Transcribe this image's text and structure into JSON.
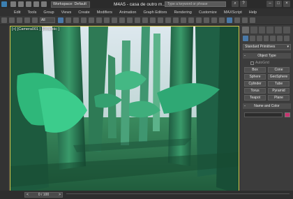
{
  "titlebar": {
    "workspace": "Workspace: Default",
    "doc_title": "M4A5 - casa de outro m...",
    "search_placeholder": "Type a keyword or phrase"
  },
  "menu": [
    "Edit",
    "Tools",
    "Group",
    "Views",
    "Create",
    "Modifiers",
    "Animation",
    "Graph Editors",
    "Rendering",
    "Customize",
    "MAXScript",
    "Help"
  ],
  "toolbar": {
    "selection_filter": "All"
  },
  "viewport": {
    "label": "[+] [Camera001 ] [Realistic ]"
  },
  "command_panel": {
    "primitive_type": "Standard Primitives",
    "object_type_header": "Object Type",
    "autogrid_label": "AutoGrid",
    "object_buttons": [
      "Box",
      "Cone",
      "Sphere",
      "GeoSphere",
      "Cylinder",
      "Tube",
      "Torus",
      "Pyramid",
      "Teapot",
      "Plane"
    ],
    "name_color_header": "Name and Color",
    "swatch_color": "#c8326e"
  },
  "timeline": {
    "frame": "0 / 100"
  },
  "colors": {
    "accent": "#4a79a8",
    "viewport_border": "#d6c64a"
  }
}
